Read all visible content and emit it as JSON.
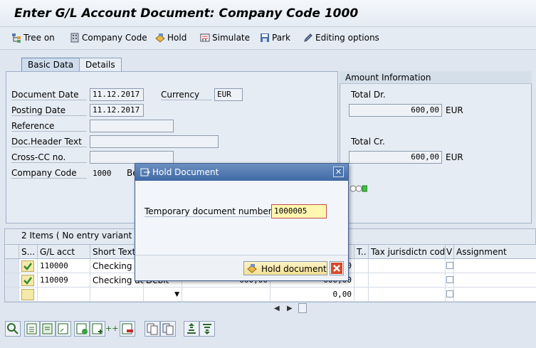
{
  "window": {
    "title": "Enter G/L Account Document: Company Code 1000"
  },
  "toolbar": {
    "tree_on": "Tree on",
    "company_code": "Company Code",
    "hold": "Hold",
    "simulate": "Simulate",
    "park": "Park",
    "editing_options": "Editing options"
  },
  "tabs": {
    "basic_data": "Basic Data",
    "details": "Details"
  },
  "basic_data": {
    "document_date_label": "Document Date",
    "document_date": "11.12.2017",
    "posting_date_label": "Posting Date",
    "posting_date": "11.12.2017",
    "currency_label": "Currency",
    "currency": "EUR",
    "reference_label": "Reference",
    "reference": "",
    "doc_header_label": "Doc.Header Text",
    "doc_header": "",
    "cross_cc_label": "Cross-CC no.",
    "cross_cc": "",
    "company_code_label": "Company Code",
    "company_code": "1000",
    "company_code_name_partial": "Be"
  },
  "amount_info": {
    "title": "Amount Information",
    "total_dr_label": "Total Dr.",
    "total_dr": "600,00",
    "total_dr_currency": "EUR",
    "total_cr_label": "Total Cr.",
    "total_cr": "600,00",
    "total_cr_currency": "EUR"
  },
  "items": {
    "header": "2 Items ( No entry variant se",
    "columns": {
      "status": "S...",
      "gl_acct": "G/L acct",
      "short_text": "Short Text",
      "t": "T..",
      "tax_jurisdiction": "Tax jurisdictn code",
      "v": "V",
      "assignment": "Assignment"
    },
    "rows": [
      {
        "gl_acct": "110000",
        "short_text": "Checking ac",
        "dc": "",
        "amount": "",
        "amount_local": "00"
      },
      {
        "gl_acct": "110009",
        "short_text": "Checking ac",
        "dc": "Debit",
        "amount": "600,00",
        "amount_local": "600,00"
      },
      {
        "gl_acct": "",
        "short_text": "",
        "dc": "",
        "amount": "",
        "amount_local": "0,00"
      }
    ]
  },
  "dialog": {
    "title": "Hold Document",
    "field_label": "Temporary document number",
    "field_value": "1000005",
    "hold_button": "Hold document"
  },
  "colors": {
    "title_bar": "#3f6aa5",
    "status_green": "#3a9a2a",
    "highlight_input": "#fff7b0"
  }
}
